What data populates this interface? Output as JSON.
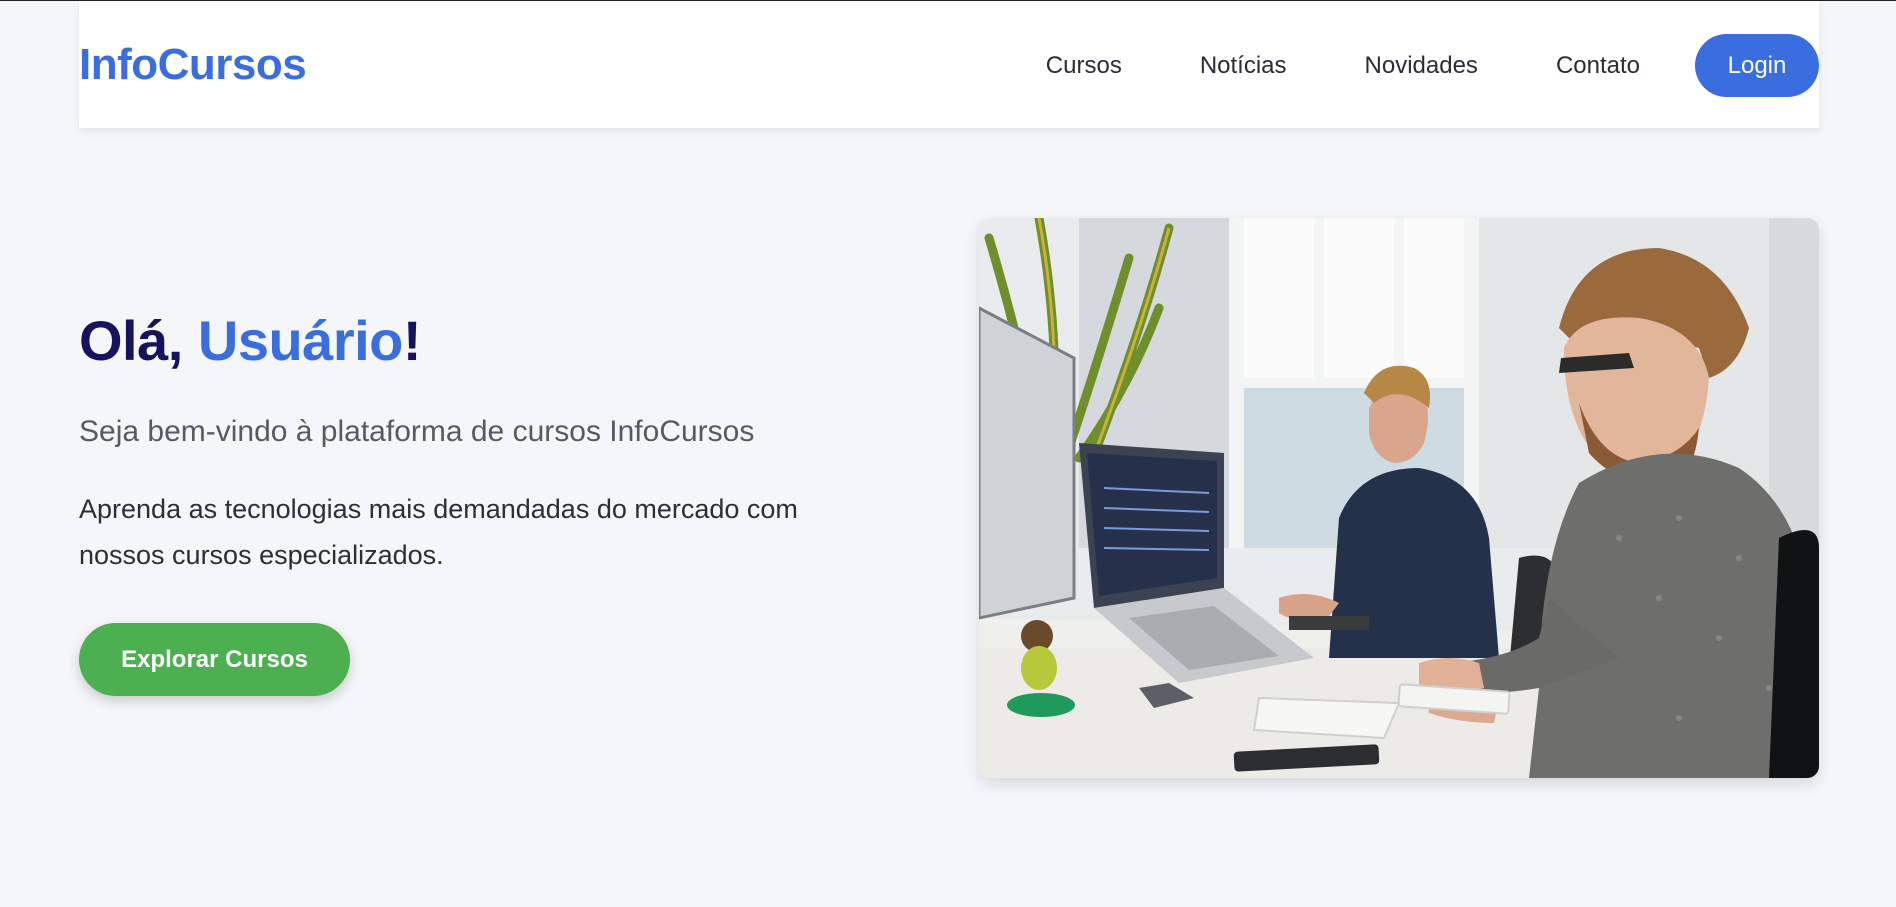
{
  "header": {
    "logo": "InfoCursos",
    "nav": [
      "Cursos",
      "Notícias",
      "Novidades",
      "Contato"
    ],
    "login_label": "Login"
  },
  "hero": {
    "greeting": "Olá, ",
    "username": "Usuário",
    "exclaim": "!",
    "subtitle": "Seja bem-vindo à plataforma de cursos InfoCursos",
    "description": "Aprenda as tecnologias mais demandadas do mercado com nossos cursos especializados.",
    "cta_label": "Explorar Cursos"
  },
  "colors": {
    "brand_blue": "#3a6ee0",
    "title_navy": "#16135e",
    "cta_green": "#4caf50",
    "page_bg": "#f4f6fa"
  },
  "icons": {
    "hero_image": "office-workers-photo"
  }
}
